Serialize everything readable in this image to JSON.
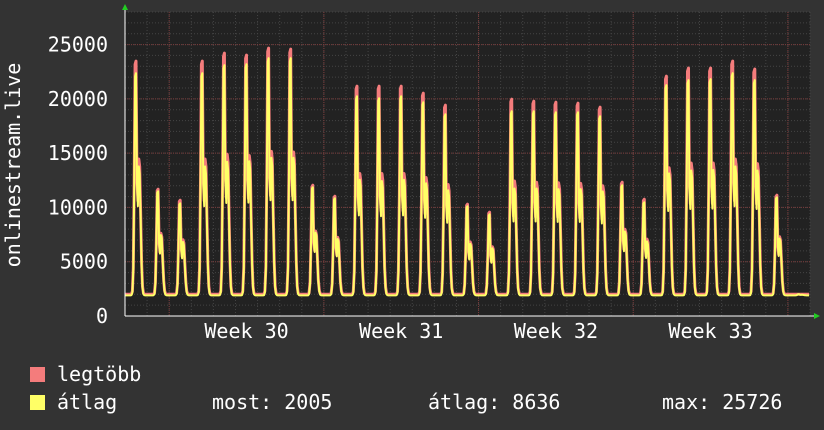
{
  "chart_data": {
    "type": "area",
    "title": "",
    "xlabel": "",
    "ylabel": "onlinestream.live",
    "ylim": [
      0,
      28000
    ],
    "yticks": [
      0,
      5000,
      10000,
      15000,
      20000,
      25000
    ],
    "xticks": [
      "Week 30",
      "Week 31",
      "Week 32",
      "Week 33"
    ],
    "grid": true,
    "legend_position": "bottom-left",
    "days_visible": 31,
    "series": [
      {
        "name": "legtöbb",
        "color": "#f47c7c",
        "daily_peaks": [
          25300,
          12500,
          11400,
          25300,
          26100,
          25900,
          26600,
          26500,
          12900,
          11800,
          22800,
          22800,
          22800,
          22100,
          20900,
          11000,
          10200,
          21500,
          21300,
          21200,
          21100,
          20700,
          13200,
          11500,
          23800,
          24600,
          24600,
          25300,
          24500,
          11900,
          2005
        ]
      },
      {
        "name": "átlag",
        "color": "#ffff66",
        "daily_peaks": [
          24100,
          12300,
          11100,
          24100,
          24900,
          25000,
          25600,
          25600,
          12700,
          11600,
          21800,
          21600,
          21800,
          21200,
          20000,
          10800,
          10000,
          20300,
          20300,
          20200,
          20200,
          19800,
          12900,
          11200,
          22900,
          23400,
          23500,
          24100,
          23400,
          11700,
          2005
        ]
      }
    ]
  },
  "legend": [
    {
      "label": "legtöbb",
      "color": "#f47c7c"
    },
    {
      "label": "átlag",
      "color": "#ffff66"
    }
  ],
  "stats": {
    "current": "most: 2005",
    "average": "átlag: 8636",
    "max": "max: 25726"
  }
}
